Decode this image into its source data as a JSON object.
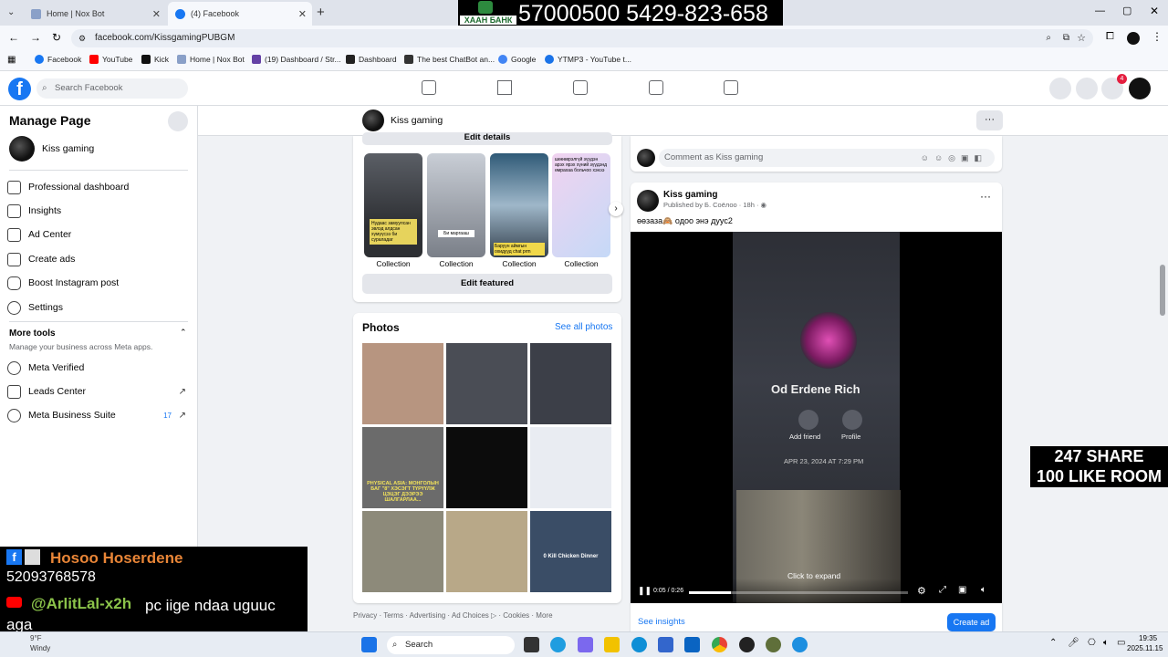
{
  "browser": {
    "tabs": [
      {
        "label": "Home | Nox Bot",
        "active": false
      },
      {
        "label": "(4) Facebook",
        "active": true
      }
    ],
    "url": "facebook.com/KissgamingPUBGM",
    "bookmarks": [
      "Facebook",
      "YouTube",
      "Kick",
      "Home | Nox Bot",
      "(19) Dashboard / Str...",
      "Dashboard",
      "The best ChatBot an...",
      "Google",
      "YTMP3 - YouTube t..."
    ]
  },
  "stream_overlay": {
    "bank_name": "ХААН БАНК",
    "bank_numbers": "57000500 5429-823-658",
    "host_name": "Hosoo Hoserdene",
    "host_phone": "52093768578",
    "youtube_handle": "@ArlitLal-x2h",
    "message": "pc iige ndaa uguuc aga",
    "share_goal_1": "247 SHARE",
    "share_goal_2": "100 LIKE ROOM"
  },
  "fb": {
    "search_placeholder": "Search Facebook",
    "notification_count": "4",
    "colors": {
      "brand": "#1877f2",
      "badge": "#e41e3f"
    }
  },
  "sidebar": {
    "title": "Manage Page",
    "page_name": "Kiss gaming",
    "items": [
      {
        "label": "Professional dashboard",
        "icon": "dashboard-icon"
      },
      {
        "label": "Insights",
        "icon": "insights-icon"
      },
      {
        "label": "Ad Center",
        "icon": "ad-center-icon"
      },
      {
        "label": "Create ads",
        "icon": "create-ads-icon"
      },
      {
        "label": "Boost Instagram post",
        "icon": "instagram-icon"
      },
      {
        "label": "Settings",
        "icon": "gear-icon"
      }
    ],
    "more_tools_title": "More tools",
    "more_tools_subtitle": "Manage your business across Meta apps.",
    "tools": [
      {
        "label": "Meta Verified"
      },
      {
        "label": "Leads Center"
      },
      {
        "label": "Meta Business Suite",
        "count": "17"
      }
    ]
  },
  "page_header": {
    "name": "Kiss gaming"
  },
  "featured": {
    "edit_details": "Edit details",
    "collections": [
      {
        "label": "Collection",
        "caption": "Нудаас замуулсан эвлэд алдсан хүмүүсээ би сураладаг"
      },
      {
        "label": "Collection",
        "caption": "Би маргааш"
      },
      {
        "label": "Collection",
        "caption": "Баруун аймгын охидууд chat рrm"
      },
      {
        "label": "Collection",
        "caption": "шөөөврэлгүй зүүдэн арэх ярэх хүний зүүдэнд өмрахаа больчоо хэнээ"
      }
    ],
    "edit_featured": "Edit featured"
  },
  "photos": {
    "title": "Photos",
    "see_all": "See all photos",
    "tile_texts": [
      "",
      "",
      "",
      "PHYSICAL ASIA: МОНГОЛЫН БАГ \"8\" ХЭСЭГТ ТҮРҮҮЛЖ ЦЭЦЭГ ДЭЭРЭЭ ШАЛГАРЛАА...",
      "",
      "",
      "",
      "",
      "0 Kill Chicken Dinner"
    ],
    "tile_colors": [
      "#b79580",
      "#4a4d55",
      "#3c3f48",
      "#6b6b6b",
      "#0c0c0c",
      "#e9ecf2",
      "#8d8a7a",
      "#b8a888",
      "#3a4d66"
    ]
  },
  "footer_links": "Privacy · Terms · Advertising · Ad Choices ▷ · Cookies · More",
  "comment_box": {
    "placeholder": "Comment as Kiss gaming"
  },
  "post": {
    "author": "Kiss gaming",
    "published_by": "Published by Б. Соёлоо",
    "time": "18h",
    "caption": "өөзаза🙈 одоо энэ дууc2",
    "video_overlay": {
      "profile_name": "Od Erdene Rich",
      "add_friend": "Add friend",
      "profile": "Profile",
      "date": "APR 23, 2024 AT 7:29 PM",
      "click_to_expand": "Click to expand",
      "time_display": "0:05 / 0:26",
      "progress": 0.19
    },
    "see_insights": "See insights",
    "create_ad": "Create ad"
  },
  "taskbar": {
    "weather_temp": "9°F",
    "weather_label": "Windy",
    "search": "Search",
    "clock_time": "19:35",
    "clock_date": "2025.11.15"
  }
}
